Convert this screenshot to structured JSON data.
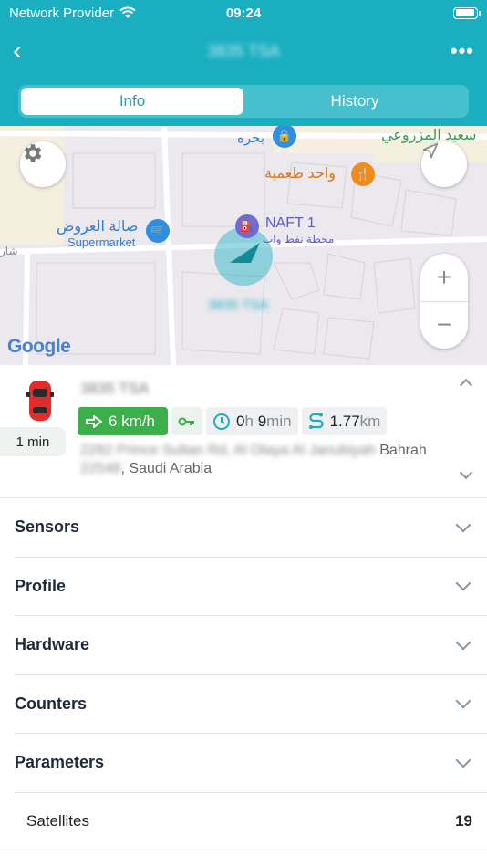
{
  "status": {
    "carrier": "Network Provider",
    "time": "09:24"
  },
  "nav": {
    "title": "3835 TSA",
    "back": "‹",
    "more": "•••"
  },
  "tabs": [
    {
      "label": "Info"
    },
    {
      "label": "History"
    }
  ],
  "map": {
    "labels": {
      "poi1": "صالة العروض",
      "poi1_sub": "Supermarket",
      "poi2": "NAFT 1",
      "poi2_sub": "محطة نفط واب",
      "poi3": "واحد طعمية",
      "poi4": "سعيد المزروعي",
      "poi5": "بحره",
      "poi6": "شار",
      "vehicle_label": "3835 TSA"
    },
    "zoom_in": "+",
    "zoom_out": "−",
    "attribution": "Google"
  },
  "device": {
    "name": "3835 TSA",
    "last_update": "1 min",
    "speed": "6 km/h",
    "duration_h": "0",
    "duration_h_unit": "h",
    "duration_m": "9",
    "duration_m_unit": "min",
    "distance": "1.77",
    "distance_unit": "km",
    "address_blurred": "2282 Prince Sultan Rd, Al Olaya Al Janubiyah",
    "address_visible": " Bahrah",
    "address_line2_blurred": "22548",
    "address_line2_visible": ", Saudi Arabia"
  },
  "sections": [
    {
      "label": "Sensors"
    },
    {
      "label": "Profile"
    },
    {
      "label": "Hardware"
    },
    {
      "label": "Counters"
    },
    {
      "label": "Parameters"
    }
  ],
  "parameters": [
    {
      "label": "Satellites",
      "value": "19"
    }
  ],
  "colors": {
    "header": "#1aafc0",
    "speed_chip": "#3aaf4a",
    "accent": "#17a6b8"
  }
}
